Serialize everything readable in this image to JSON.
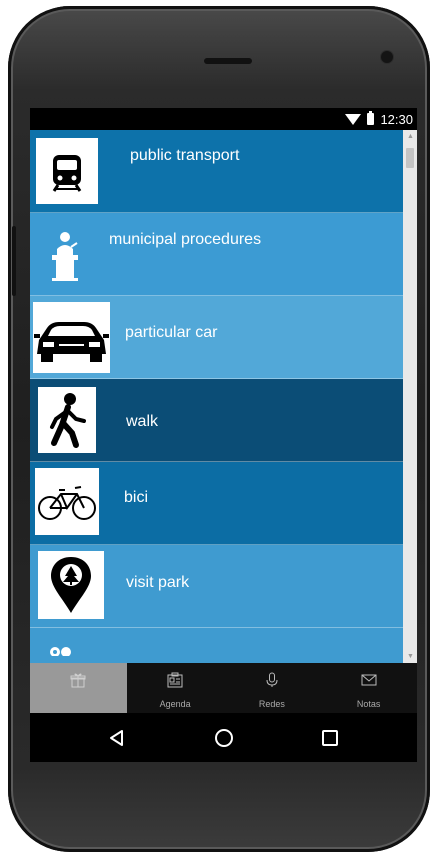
{
  "status_bar": {
    "time": "12:30"
  },
  "menu_items": [
    {
      "label": "public transport",
      "icon": "train-icon",
      "bg": "#0d72aa"
    },
    {
      "label": "municipal procedures",
      "icon": "speaker-podium-icon",
      "bg": "#3c9bd3"
    },
    {
      "label": "particular car",
      "icon": "car-icon",
      "bg": "#52a8d8"
    },
    {
      "label": "walk",
      "icon": "walking-person-icon",
      "bg": "#0b4d76"
    },
    {
      "label": "bici",
      "icon": "bicycle-icon",
      "bg": "#0c6da4"
    },
    {
      "label": "visit park",
      "icon": "park-pin-icon",
      "bg": "#3f9bd0"
    }
  ],
  "tabs": [
    {
      "label": "",
      "icon": "gift-icon",
      "active": true
    },
    {
      "label": "Agenda",
      "icon": "agenda-icon",
      "active": false
    },
    {
      "label": "Redes",
      "icon": "microphone-icon",
      "active": false
    },
    {
      "label": "Notas",
      "icon": "envelope-icon",
      "active": false
    }
  ],
  "nav_buttons": [
    "back-icon",
    "home-icon",
    "recents-icon"
  ],
  "colors": {
    "statusbar": "#000000",
    "tabbar": "#111111",
    "tab_active": "#999999"
  }
}
